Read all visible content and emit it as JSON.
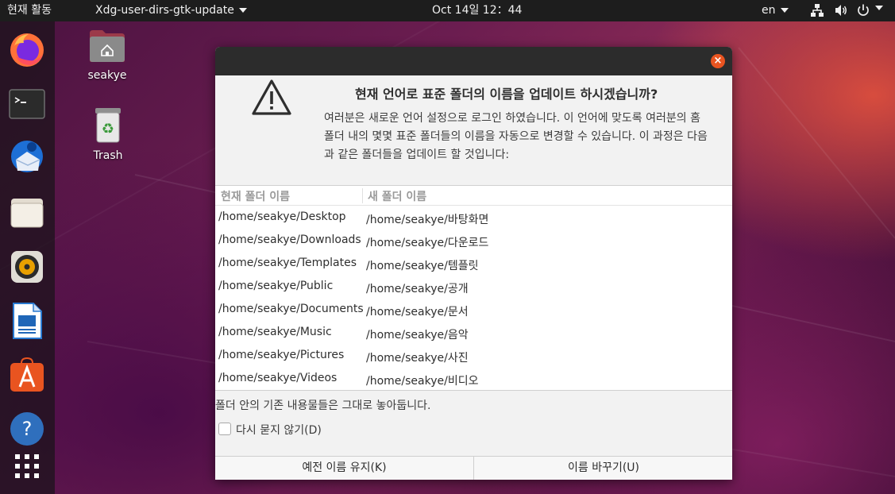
{
  "topbar": {
    "activities": "현재 활동",
    "app_menu": "Xdg-user-dirs-gtk-update",
    "clock": "Oct 14일  12：44",
    "lang": "en"
  },
  "dock": {
    "items": [
      "firefox-icon",
      "terminal-icon",
      "thunderbird-icon",
      "files-icon",
      "rhythmbox-icon",
      "libreoffice-writer-icon",
      "ubuntu-software-icon",
      "help-icon",
      "show-apps-icon"
    ]
  },
  "desktop": {
    "home_label": "seakye",
    "trash_label": "Trash"
  },
  "dialog": {
    "title": "현재 언어로 표준 폴더의 이름을 업데이트 하시겠습니까?",
    "body": "여러분은 새로운 언어 설정으로 로그인 하였습니다. 이 언어에 맞도록 여러분의 홈 폴더 내의 몇몇 표준 폴더들의 이름을 자동으로 변경할 수 있습니다. 이 과정은 다음과 같은 폴더들을 업데이트 할 것입니다:",
    "table": {
      "headers": [
        "현재 폴더 이름",
        "새 폴더 이름"
      ],
      "rows": [
        [
          "/home/seakye/Desktop",
          "/home/seakye/바탕화면"
        ],
        [
          "/home/seakye/Downloads",
          "/home/seakye/다운로드"
        ],
        [
          "/home/seakye/Templates",
          "/home/seakye/템플릿"
        ],
        [
          "/home/seakye/Public",
          "/home/seakye/공개"
        ],
        [
          "/home/seakye/Documents",
          "/home/seakye/문서"
        ],
        [
          "/home/seakye/Music",
          "/home/seakye/음악"
        ],
        [
          "/home/seakye/Pictures",
          "/home/seakye/사진"
        ],
        [
          "/home/seakye/Videos",
          "/home/seakye/비디오"
        ]
      ]
    },
    "note": "폴더 안의 기존 내용물들은 그대로 놓아둡니다.",
    "checkbox_label": "다시 묻지 않기(D)",
    "checkbox_checked": false,
    "keep_button": "예전 이름 유지(K)",
    "update_button": "이름 바꾸기(U)"
  },
  "colors": {
    "accent": "#e95420",
    "topbar": "#1d1d1d",
    "dialog_header": "#2c2c2c"
  }
}
